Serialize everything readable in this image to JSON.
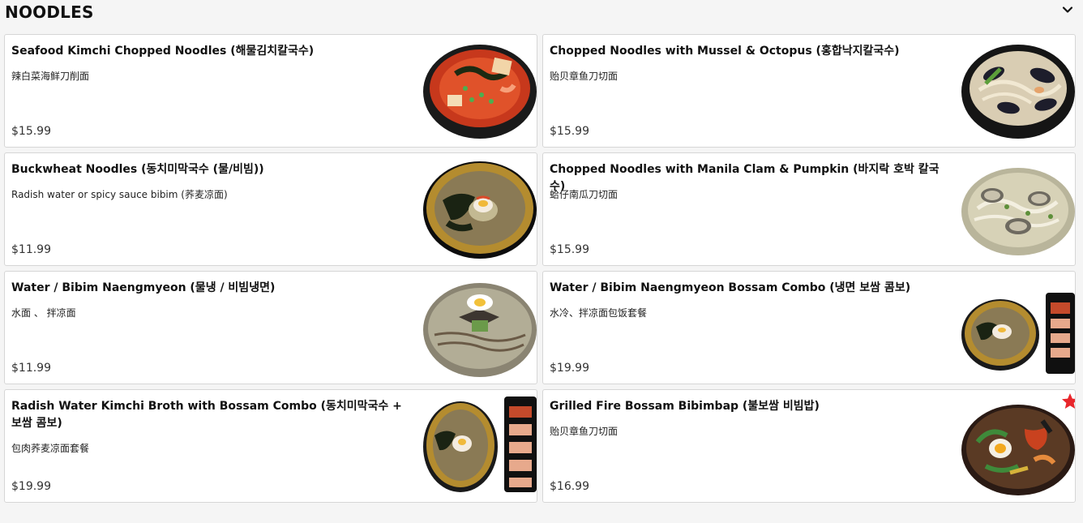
{
  "section": {
    "title": "NOODLES",
    "toggle_icon": "chevron-down-icon"
  },
  "items": [
    {
      "name": "Seafood Kimchi Chopped Noodles (해물김치칼국수)",
      "description": "辣白菜海鲜刀削面",
      "price": "$15.99",
      "image": "red-spicy-noodle-bowl"
    },
    {
      "name": "Chopped Noodles with Mussel & Octopus (홍합낙지칼국수)",
      "description": "贻贝章鱼刀切面",
      "price": "$15.99",
      "image": "mussel-noodle-bowl"
    },
    {
      "name": "Buckwheat Noodles (동치미막국수 (물/비빔))",
      "description": "Radish water or spicy sauce bibim (荞麦凉面)",
      "price": "$11.99",
      "image": "gold-bowl-buckwheat-noodles"
    },
    {
      "name": "Chopped Noodles with Manila Clam & Pumpkin (바지락 호박 칼국수)",
      "description": "蛤仔南瓜刀切面",
      "price": "$15.99",
      "image": "clam-noodle-soup"
    },
    {
      "name": "Water / Bibim Naengmyeon (물냉 / 비빔냉면)",
      "description": "水面 、 拌凉面",
      "price": "$11.99",
      "image": "cold-noodle-bowl-egg"
    },
    {
      "name": "Water / Bibim Naengmyeon Bossam Combo (냉면 보쌈 콤보)",
      "description": "水冷、拌凉面包饭套餐",
      "price": "$19.99",
      "image": "naengmyeon-bossam-combo"
    },
    {
      "name": "Radish Water Kimchi Broth with Bossam Combo (동치미막국수 + 보쌈 콤보)",
      "description": "包肉荞麦凉面套餐",
      "price": "$19.99",
      "image": "buckwheat-bossam-combo"
    },
    {
      "name": "Grilled Fire Bossam Bibimbap (불보쌈 비빔밥)",
      "description": "贻贝章鱼刀切面",
      "price": "$16.99",
      "image": "bibimbap-bowl"
    }
  ],
  "colors": {
    "background": "#f5f5f5",
    "card": "#ffffff",
    "border": "#d6d6d6",
    "badge_star": "#e8262b"
  }
}
